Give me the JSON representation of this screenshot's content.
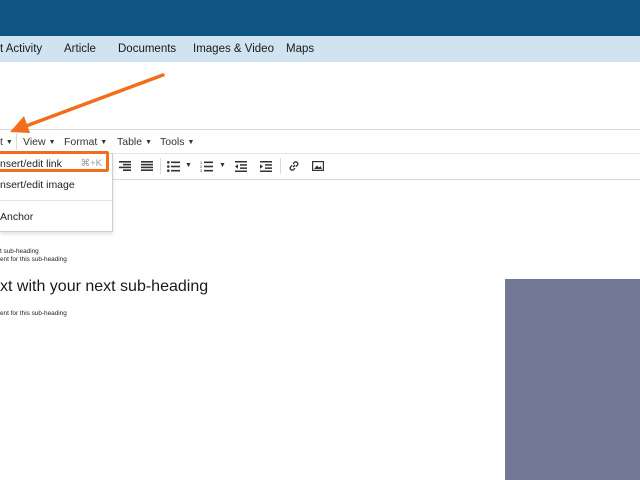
{
  "nav": {
    "items": [
      "t Activity",
      "Article",
      "Documents",
      "Images & Video",
      "Maps"
    ]
  },
  "menubar": {
    "items": [
      "t",
      "View",
      "Format",
      "Table",
      "Tools"
    ]
  },
  "dropdown": {
    "items": [
      {
        "label": "nsert/edit link",
        "shortcut": "⌘+K"
      },
      {
        "label": "nsert/edit image"
      },
      {
        "label": "Anchor"
      }
    ]
  },
  "content": {
    "sub_heading_1_line1": "t sub-heading",
    "sub_heading_1_line2": "ent for this sub-heading",
    "heading": "xt with your next sub-heading",
    "sub_heading_2_line": "ent for this sub-heading"
  },
  "colors": {
    "topbar": "#0f5583",
    "navbar": "#cfe4f0",
    "accent_orange": "#f06e1c",
    "image_block": "#727796"
  },
  "icons": [
    "align-right-icon",
    "align-justify-icon",
    "bullet-list-icon",
    "numbered-list-icon",
    "outdent-icon",
    "indent-icon",
    "link-icon",
    "image-icon"
  ]
}
